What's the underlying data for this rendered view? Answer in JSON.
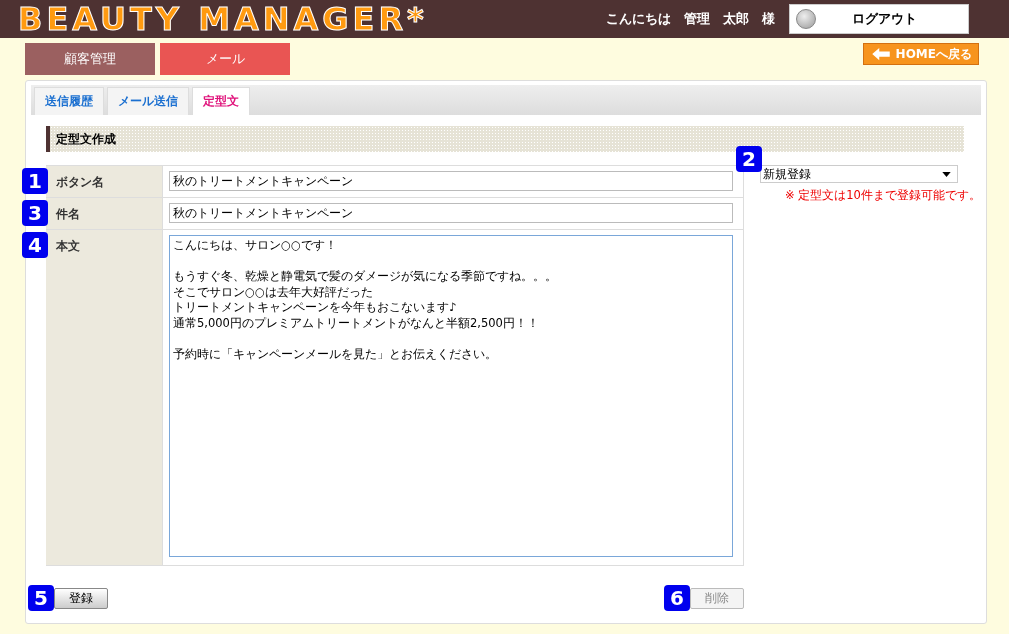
{
  "header": {
    "logo": "BEAUTY MANAGER*",
    "greeting": "こんにちは　管理　太郎　様",
    "logout": "ログアウト"
  },
  "nav": [
    {
      "label": "顧客管理",
      "selected": false
    },
    {
      "label": "メール",
      "selected": true
    }
  ],
  "home_button": "HOMEへ戻る",
  "subtabs": [
    {
      "label": "送信履歴",
      "selected": false
    },
    {
      "label": "メール送信",
      "selected": false
    },
    {
      "label": "定型文",
      "selected": true
    }
  ],
  "section_title": "定型文作成",
  "form": [
    {
      "badge": "1",
      "label": "ボタン名",
      "kind": "input",
      "value": "秋のトリートメントキャンペーン"
    },
    {
      "badge": "3",
      "label": "件名",
      "kind": "input",
      "value": "秋のトリートメントキャンペーン"
    },
    {
      "badge": "4",
      "label": "本文",
      "kind": "textarea",
      "paragraphs": [
        [
          "こんにちは、サロン○○です！"
        ],
        [
          "もうすぐ冬、乾燥と静電気で髪のダメージが気になる季節ですね。。。",
          "そこでサロン○○は去年大好評だった",
          "トリートメントキャンペーンを今年もおこないます♪",
          "通常5,000円のプレミアムトリートメントがなんと半額2,500円！！"
        ],
        [
          "予約時に「キャンペーンメールを見た」とお伝えください。"
        ]
      ]
    }
  ],
  "template_select": {
    "badge": "2",
    "value": "新規登録",
    "note": "※ 定型文は10件まで登録可能です。"
  },
  "buttons": [
    {
      "badge": "5",
      "label": "登録",
      "disabled": false
    },
    {
      "badge": "6",
      "label": "削除",
      "disabled": true
    }
  ]
}
